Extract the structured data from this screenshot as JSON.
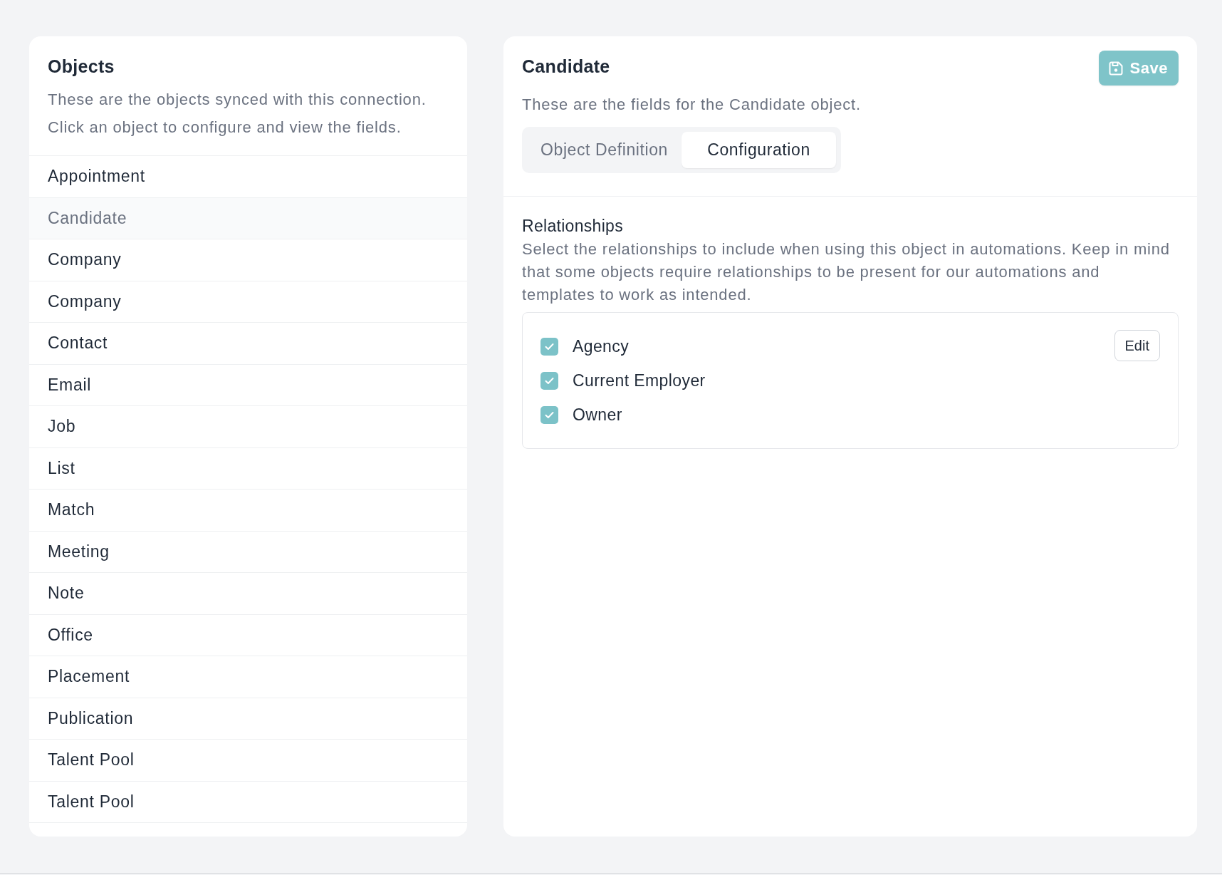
{
  "objects_panel": {
    "title": "Objects",
    "description_lines": [
      "These are the objects synced with this connection.",
      "Click an object to configure and view the fields."
    ],
    "items": [
      {
        "label": "Appointment",
        "selected": false
      },
      {
        "label": "Candidate",
        "selected": true
      },
      {
        "label": "Company",
        "selected": false
      },
      {
        "label": "Company",
        "selected": false
      },
      {
        "label": "Contact",
        "selected": false
      },
      {
        "label": "Email",
        "selected": false
      },
      {
        "label": "Job",
        "selected": false
      },
      {
        "label": "List",
        "selected": false
      },
      {
        "label": "Match",
        "selected": false
      },
      {
        "label": "Meeting",
        "selected": false
      },
      {
        "label": "Note",
        "selected": false
      },
      {
        "label": "Office",
        "selected": false
      },
      {
        "label": "Placement",
        "selected": false
      },
      {
        "label": "Publication",
        "selected": false
      },
      {
        "label": "Talent Pool",
        "selected": false
      },
      {
        "label": "Talent Pool",
        "selected": false
      }
    ]
  },
  "detail_panel": {
    "title": "Candidate",
    "save_button": "Save",
    "description": "These are the fields for the Candidate object.",
    "tabs": [
      {
        "label": "Object Definition",
        "selected": false
      },
      {
        "label": "Configuration",
        "selected": true
      }
    ],
    "relationships": {
      "title": "Relationships",
      "description": "Select the relationships to include when using this object in automations. Keep in mind that some objects require relationships to be present for our automations and templates to work as intended.",
      "items": [
        {
          "label": "Agency",
          "checked": true
        },
        {
          "label": "Current Employer",
          "checked": true
        },
        {
          "label": "Owner",
          "checked": true
        }
      ],
      "edit_button": "Edit"
    }
  }
}
